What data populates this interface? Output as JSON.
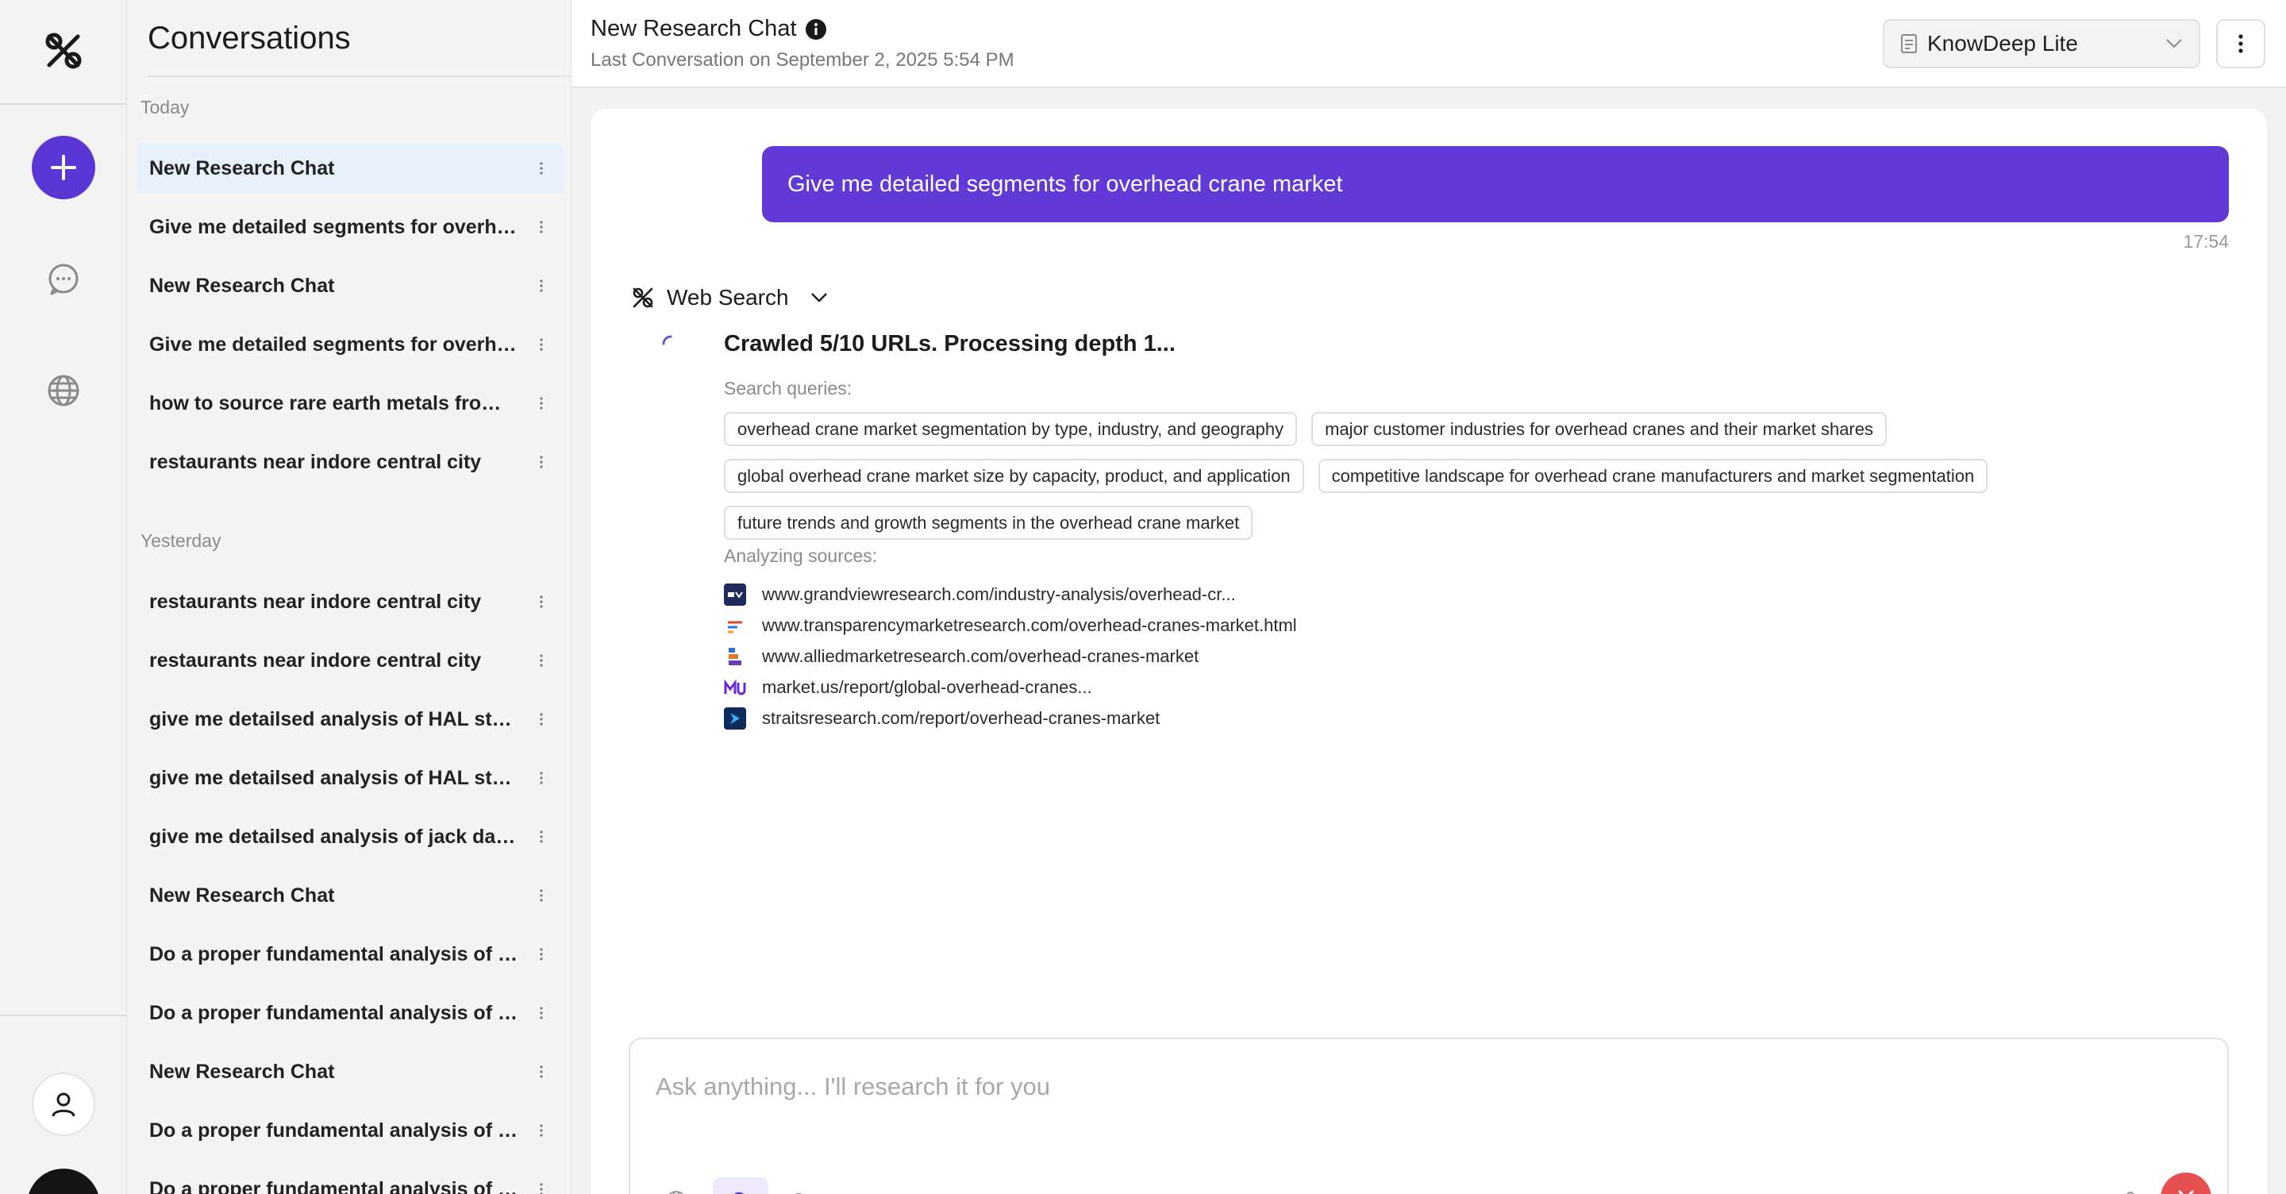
{
  "rail": {
    "logo_icon": "knowdeep-logo",
    "new_chat_icon": "plus-icon",
    "chats_icon": "chat-bubble-icon",
    "web_icon": "globe-icon",
    "profile_icon": "user-icon"
  },
  "sidebar": {
    "title": "Conversations",
    "sections": [
      {
        "label": "Today",
        "items": [
          {
            "label": "New Research Chat",
            "active": true
          },
          {
            "label": "Give me detailed segments for overhead crane market",
            "active": false
          },
          {
            "label": "New Research Chat",
            "active": false
          },
          {
            "label": "Give me detailed segments for overhead crane market",
            "active": false
          },
          {
            "label": "how to source rare earth metals from China",
            "active": false
          },
          {
            "label": "restaurants near indore central city",
            "active": false
          }
        ]
      },
      {
        "label": "Yesterday",
        "items": [
          {
            "label": "restaurants near indore central city",
            "active": false
          },
          {
            "label": "restaurants near indore central city",
            "active": false
          },
          {
            "label": "give me detailsed analysis of HAL stock",
            "active": false
          },
          {
            "label": "give me detailsed analysis of HAL stock",
            "active": false
          },
          {
            "label": "give me detailsed analysis of jack daniels",
            "active": false
          },
          {
            "label": "New Research Chat",
            "active": false
          },
          {
            "label": "Do a proper fundamental analysis of a company",
            "active": false
          },
          {
            "label": "Do a proper fundamental analysis of each",
            "active": false
          },
          {
            "label": "New Research Chat",
            "active": false
          },
          {
            "label": "Do a proper fundamental analysis of Company",
            "active": false
          },
          {
            "label": "Do a proper fundamental analysis of Company",
            "active": false
          }
        ]
      }
    ]
  },
  "header": {
    "title": "New Research Chat",
    "subtitle": "Last Conversation on September 2, 2025 5:54 PM",
    "model": "KnowDeep Lite"
  },
  "chat": {
    "user_message": "Give me detailed segments for overhead crane market",
    "time": "17:54",
    "web_search_label": "Web Search",
    "status": "Crawled 5/10 URLs. Processing depth 1...",
    "queries_label": "Search queries:",
    "queries": [
      "overhead crane market segmentation by type, industry, and geography",
      "major customer industries for overhead cranes and their market shares",
      "global overhead crane market size by capacity, product, and application",
      "competitive landscape for overhead crane manufacturers and market segmentation",
      "future trends and growth segments in the overhead crane market"
    ],
    "sources_label": "Analyzing sources:",
    "sources": [
      "www.grandviewresearch.com/industry-analysis/overhead-cr...",
      "www.transparencymarketresearch.com/overhead-cranes-market.html",
      "www.alliedmarketresearch.com/overhead-cranes-market",
      "market.us/report/global-overhead-cranes...",
      "straitsresearch.com/report/overhead-cranes-market"
    ]
  },
  "composer": {
    "placeholder": "Ask anything... I'll research it for you"
  },
  "colors": {
    "accent": "#6238d6",
    "active_item": "#e6f1fb",
    "stop": "#e55050"
  }
}
